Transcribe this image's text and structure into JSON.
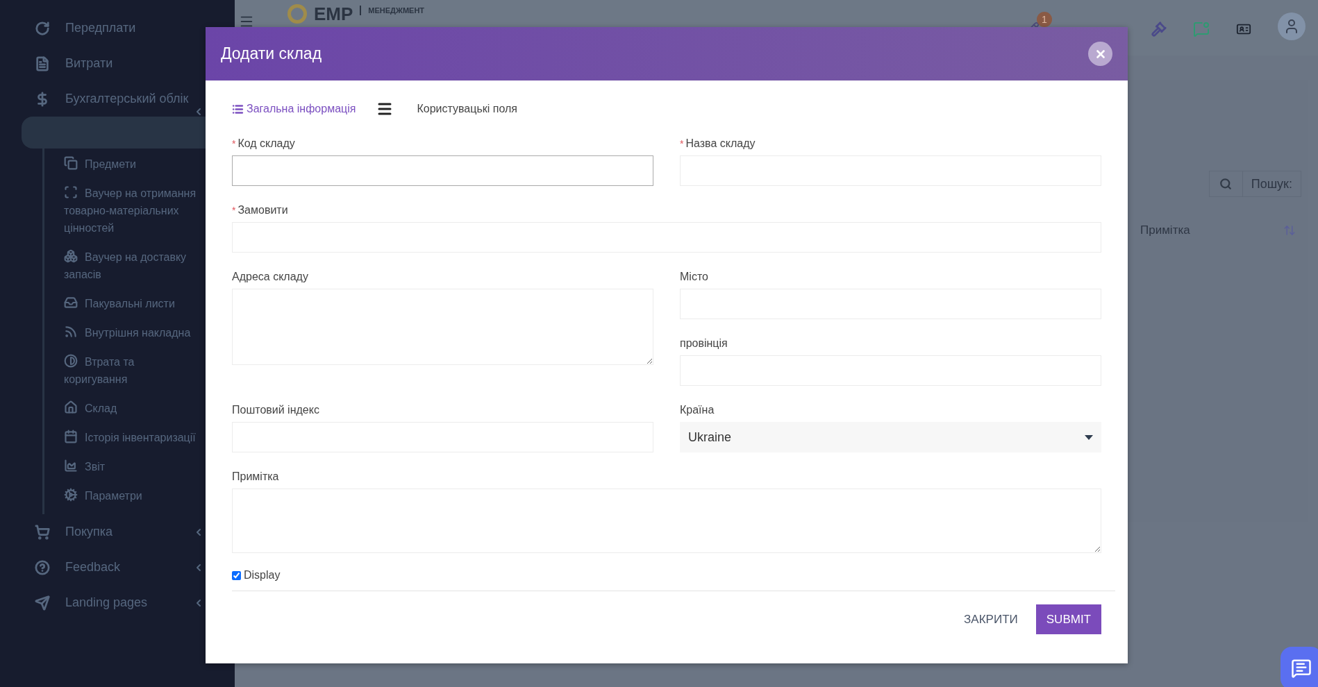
{
  "sidebar": {
    "items": [
      {
        "label": "Передплати",
        "submenu": false
      },
      {
        "label": "Витрати",
        "submenu": false
      },
      {
        "label": "Бухгалтерський облік",
        "submenu": true,
        "expanded": true,
        "children": [
          {
            "label": "Предмети"
          },
          {
            "label": "Ваучер на отримання товарно-матеріальних цінностей"
          },
          {
            "label": "Ваучер на доставку запасів"
          },
          {
            "label": "Пакувальні листи"
          },
          {
            "label": "Внутрішня накладна"
          },
          {
            "label": "Втрата та коригування"
          },
          {
            "label": "Склад"
          },
          {
            "label": "Історія інвентаризації"
          },
          {
            "label": "Звіт"
          },
          {
            "label": "Параметри"
          }
        ]
      },
      {
        "label": "Покупка",
        "submenu": true
      },
      {
        "label": "Feedback",
        "submenu": true
      },
      {
        "label": "Landing pages",
        "submenu": true
      }
    ]
  },
  "top_bar": {
    "logo": "EMP",
    "logo_caption": "МЕНЕДЖМЕНТ",
    "notification_count": "1"
  },
  "background_table": {
    "search_placeholder": "Пошук:",
    "column": "Примітка"
  },
  "modal": {
    "title": "Додати склад",
    "tabs": [
      {
        "label": "Загальна інформація",
        "selected": true
      },
      {
        "label": "Користувацькі поля",
        "selected": false
      }
    ],
    "fields": [
      {
        "label": "Код складу",
        "required_mark": "*",
        "kind": "input",
        "focused": true
      },
      {
        "label": "Назва складу",
        "required_mark": "*",
        "kind": "input",
        "focused": false
      },
      {
        "label": "Замовити",
        "required_mark": "*",
        "kind": "input",
        "focused": false
      },
      {
        "label": "Адреса складу",
        "kind": "textarea",
        "focused": false
      },
      {
        "label": "Місто",
        "kind": "input",
        "focused": false
      },
      {
        "label": "провінція",
        "kind": "input",
        "focused": false
      },
      {
        "label": "Поштовий індекс",
        "kind": "input",
        "focused": false
      },
      {
        "label": "Країна",
        "kind": "select",
        "value": "Ukraine"
      },
      {
        "label": "Примітка",
        "kind": "textarea",
        "focused": false
      }
    ],
    "display": {
      "label": "Display",
      "checked": true
    },
    "buttons": [
      {
        "label": "ЗАКРИТИ",
        "kind": "text"
      },
      {
        "label": "SUBMIT",
        "kind": "primary"
      }
    ]
  }
}
